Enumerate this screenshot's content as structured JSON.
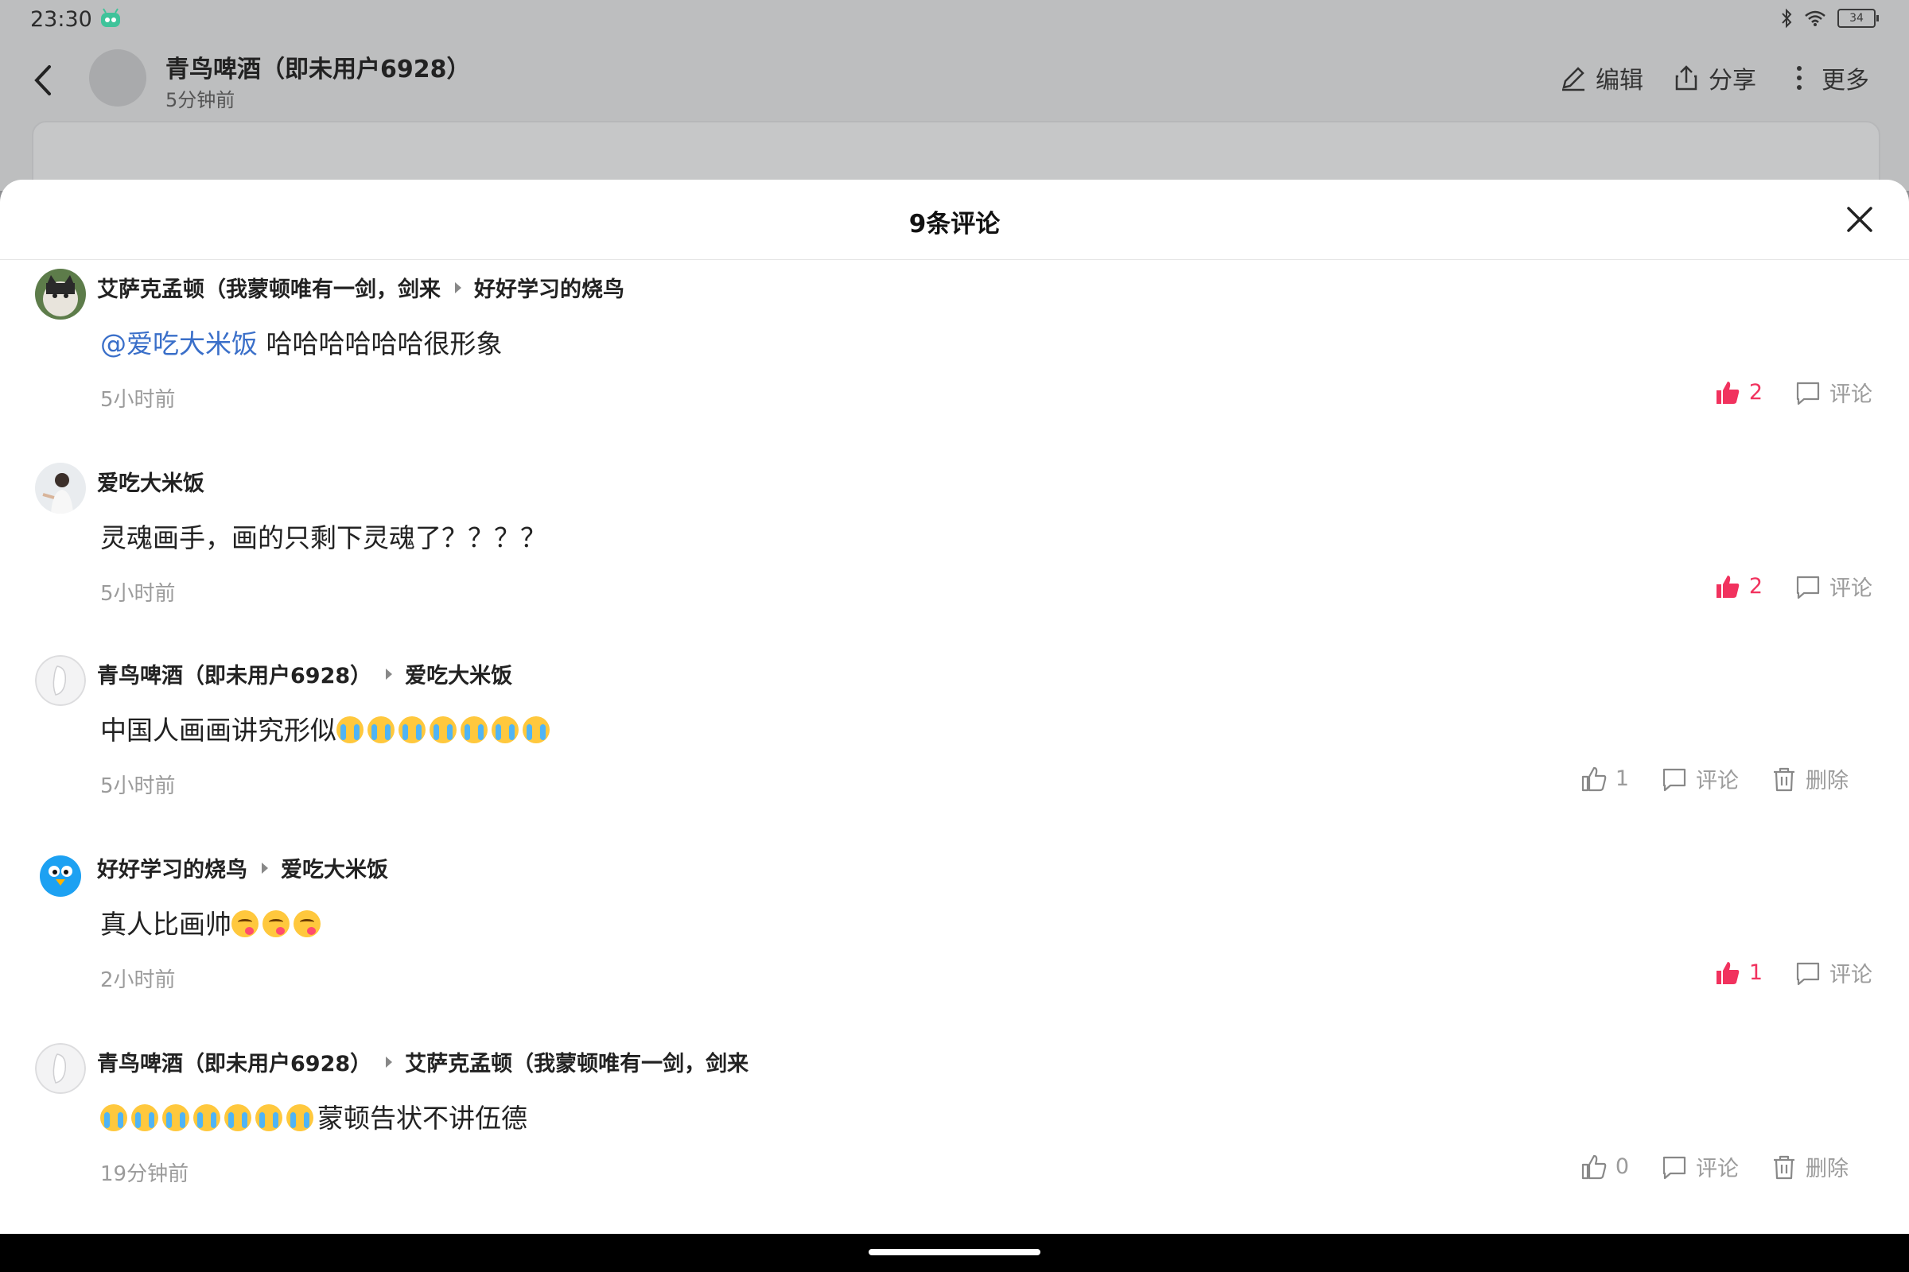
{
  "status_bar": {
    "time": "23:30",
    "battery": "34"
  },
  "post_header": {
    "author": "青鸟啤酒（即未用户6928）",
    "time": "5分钟前",
    "actions": [
      {
        "label": "编辑",
        "icon": "edit-icon"
      },
      {
        "label": "分享",
        "icon": "share-icon"
      },
      {
        "label": "更多",
        "icon": "more-icon"
      }
    ]
  },
  "sheet": {
    "title": "9条评论"
  },
  "comments": [
    {
      "user": "艾萨克孟顿（我蒙顿唯有一剑，剑来",
      "reply_to": "好好学习的烧鸟",
      "mention": "@爱吃大米饭",
      "text": " 哈哈哈哈哈哈很形象",
      "time": "5小时前",
      "likes": "2",
      "liked": true,
      "comment_label": "评论"
    },
    {
      "user": "爱吃大米饭",
      "reply_to": "",
      "mention": "",
      "text": "灵魂画手，画的只剩下灵魂了？？？？",
      "time": "5小时前",
      "likes": "2",
      "liked": true,
      "comment_label": "评论"
    },
    {
      "user": "青鸟啤酒（即未用户6928）",
      "reply_to": "爱吃大米饭",
      "mention": "",
      "text": "中国人画画讲究形似",
      "emoji": "loudly-crying-face",
      "emoji_count": 7,
      "time": "5小时前",
      "likes": "1",
      "liked": false,
      "comment_label": "评论",
      "delete_label": "删除"
    },
    {
      "user": "好好学习的烧鸟",
      "reply_to": "爱吃大米饭",
      "mention": "",
      "text": "真人比画帅",
      "emoji": "face-savoring-food",
      "emoji_count": 3,
      "time": "2小时前",
      "likes": "1",
      "liked": true,
      "comment_label": "评论"
    },
    {
      "user": "青鸟啤酒（即未用户6928）",
      "reply_to": "艾萨克孟顿（我蒙顿唯有一剑，剑来",
      "mention": "",
      "emoji_prefix": "loudly-crying-face",
      "emoji_count": 7,
      "text": "蒙顿告状不讲伍德",
      "time": "19分钟前",
      "likes": "0",
      "liked": false,
      "comment_label": "评论",
      "delete_label": "删除"
    }
  ]
}
